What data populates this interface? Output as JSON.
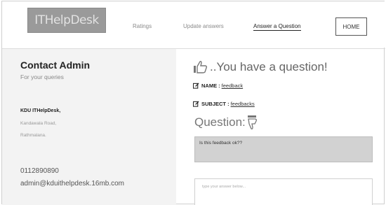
{
  "header": {
    "logo_text": "ITHelpDesk",
    "nav": {
      "ratings": "Ratings",
      "update_answers": "Update answers",
      "answer_question": "Answer a Question",
      "home": "HOME"
    }
  },
  "sidebar": {
    "title": "Contact Admin",
    "subtitle": "For your queries",
    "org_name": "KDU ITHelpDesk,",
    "address_line1": "Kandawala Road,",
    "address_line2": "Rathmalana.",
    "phone": "0112890890",
    "email": "admin@kduithelpdesk.16mb.com"
  },
  "main": {
    "heading": "..You have a question!",
    "name_label": "NAME :",
    "name_value": "feedback",
    "subject_label": "SUBJECT :",
    "subject_value": "feedbacks",
    "question_heading": "Question:",
    "question_text": "Is this feedback ok??",
    "answer_placeholder": "type your answer below..."
  },
  "colors": {
    "logo_bg": "#9a9a9a",
    "sidebar_bg": "#f3f3f3",
    "question_bg": "#d2d2d2"
  },
  "icons": {
    "heading_icon": "thumbs-up-icon",
    "question_icon": "thumbs-down-icon",
    "field_icon": "edit-icon"
  }
}
